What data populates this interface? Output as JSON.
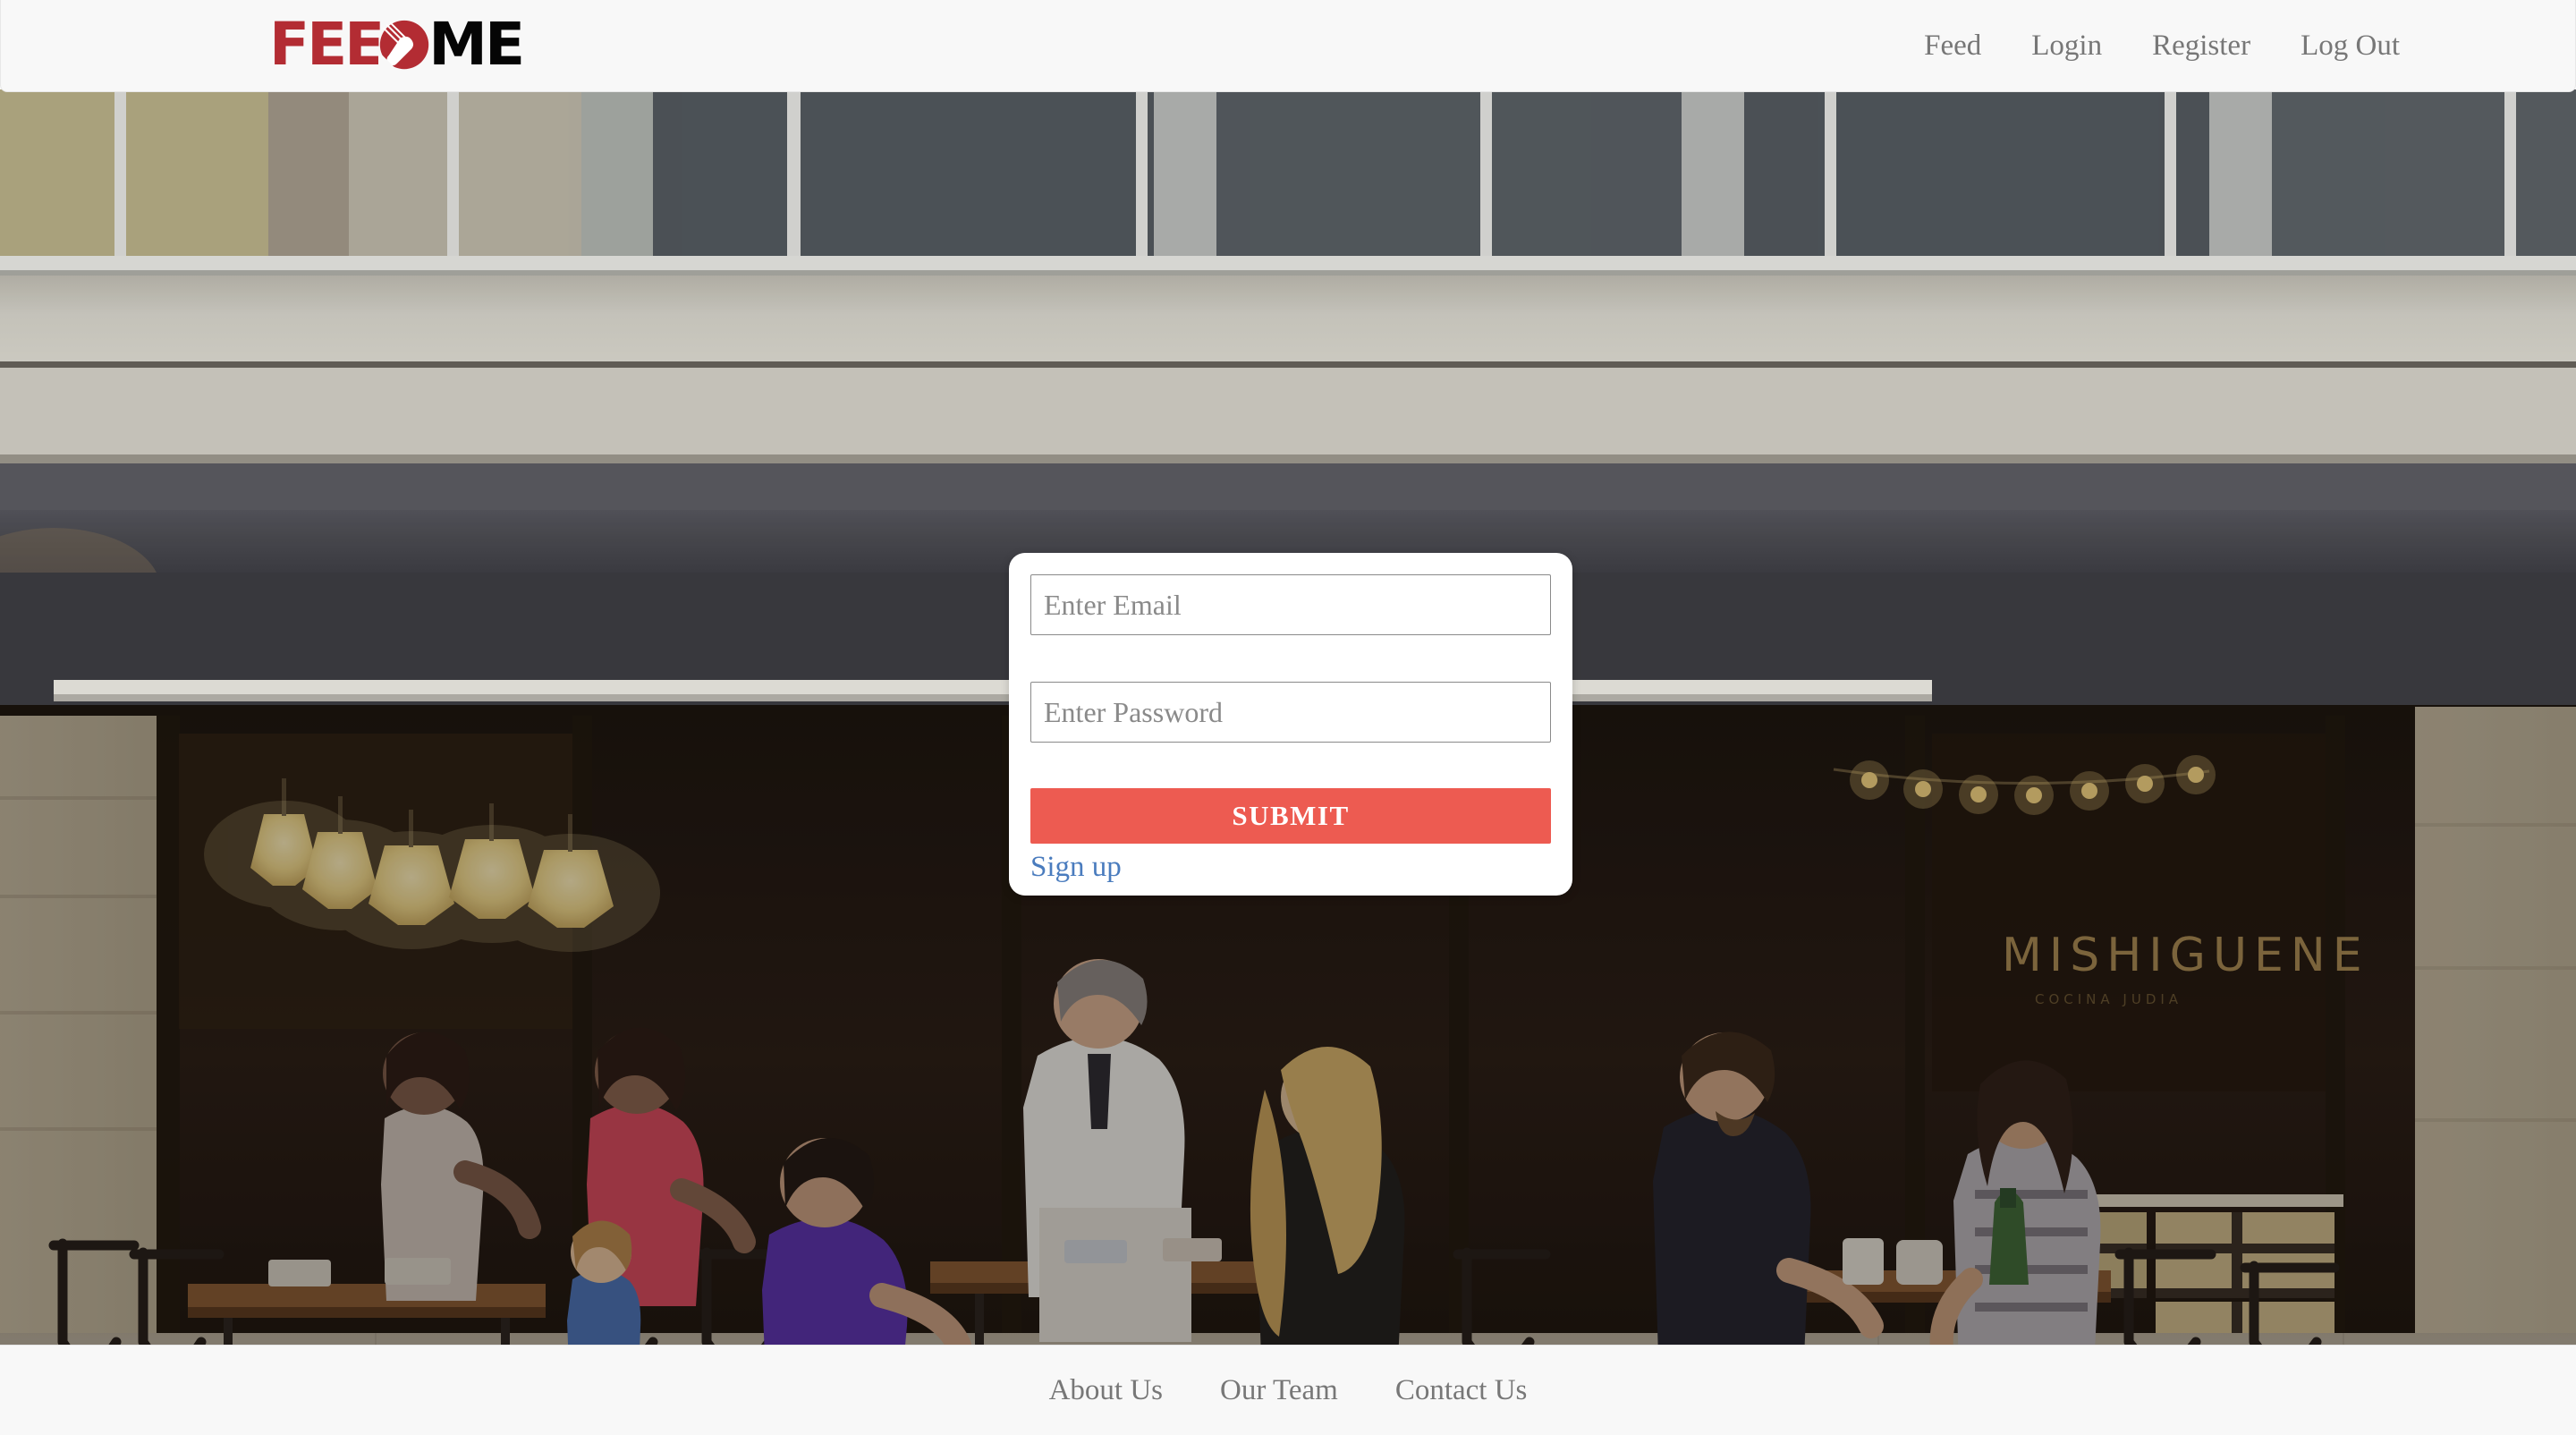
{
  "header": {
    "logo": {
      "part1": "FEE",
      "icon": "fork-circle-icon",
      "part2": "ME",
      "full_text": "FEED ME",
      "color_primary": "#b32c33",
      "color_secondary": "#050505"
    },
    "nav": [
      {
        "label": "Feed",
        "name": "nav-link-feed"
      },
      {
        "label": "Login",
        "name": "nav-link-login"
      },
      {
        "label": "Register",
        "name": "nav-link-register"
      },
      {
        "label": "Log Out",
        "name": "nav-link-logout"
      }
    ]
  },
  "hero": {
    "description": "Outdoor sidewalk cafe terrace with diners seated at tables under a dark awning",
    "signs": {
      "awning": "MISHIGUENE",
      "window": "MISHIGUENE"
    },
    "overlay_color": "#4a4a50"
  },
  "login": {
    "email": {
      "placeholder": "Enter Email",
      "value": ""
    },
    "password": {
      "placeholder": "Enter Password",
      "value": ""
    },
    "submit_label": "SUBMIT",
    "submit_color": "#ed5b51",
    "signup_label": "Sign up",
    "signup_color": "#4a7cbe"
  },
  "footer": {
    "links": [
      {
        "label": "About Us",
        "name": "footer-link-about-us"
      },
      {
        "label": "Our Team",
        "name": "footer-link-our-team"
      },
      {
        "label": "Contact Us",
        "name": "footer-link-contact-us"
      }
    ]
  }
}
